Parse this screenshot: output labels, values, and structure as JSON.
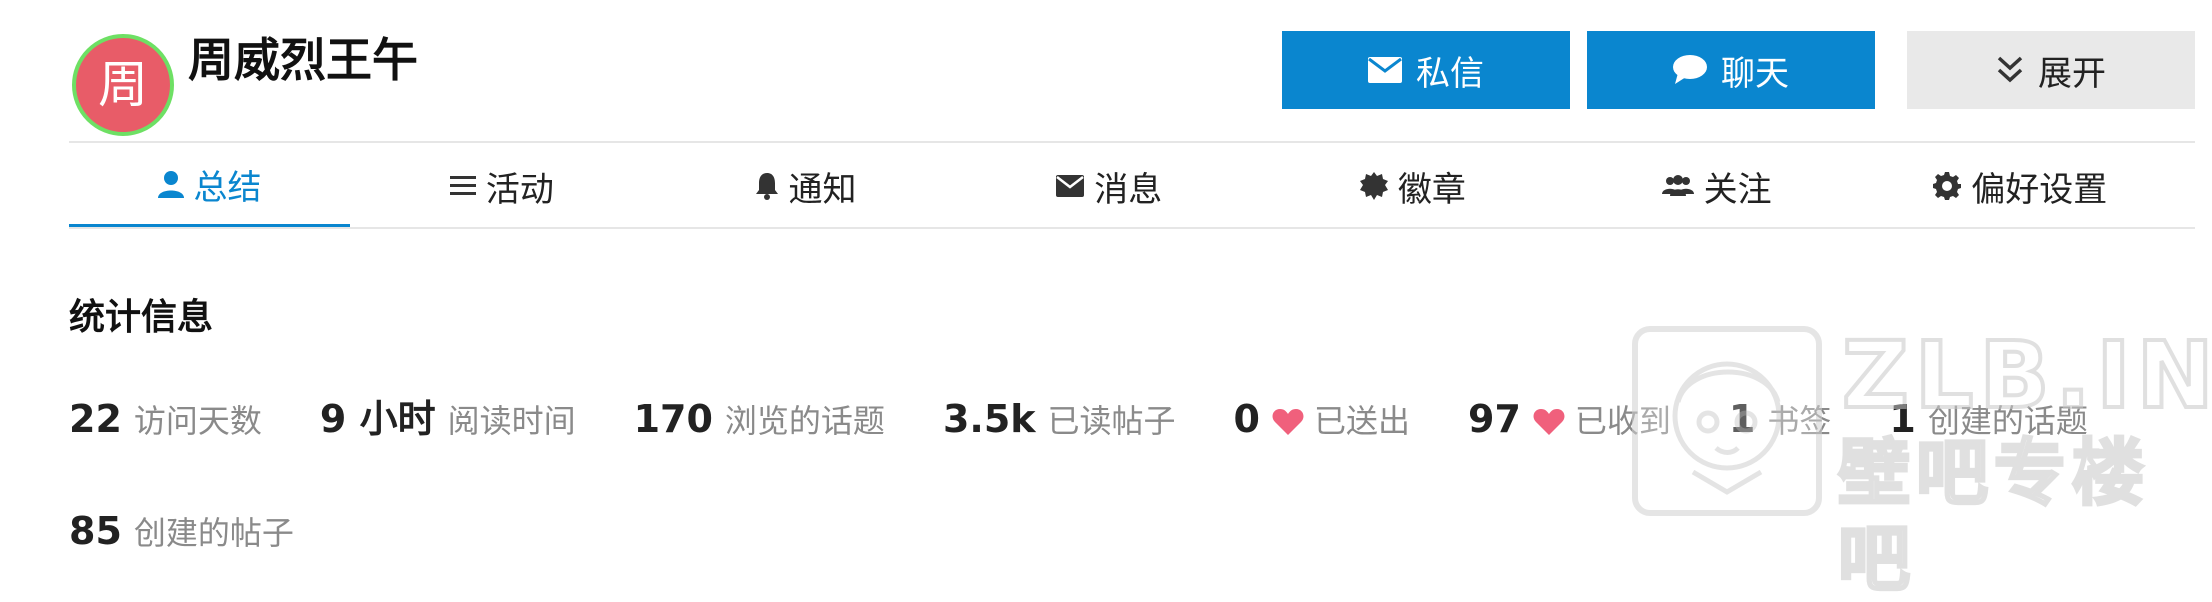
{
  "profile": {
    "avatar_letter": "周",
    "avatar_color": "#e85c68",
    "avatar_ring_color": "#6ee064",
    "username": "周威烈王午"
  },
  "actions": {
    "pm": {
      "label": "私信",
      "icon": "envelope-icon"
    },
    "chat": {
      "label": "聊天",
      "icon": "speech-bubble-icon"
    },
    "expand": {
      "label": "展开",
      "icon": "double-chevron-down-icon"
    }
  },
  "nav": {
    "items": [
      {
        "label": "总结",
        "icon": "user-icon",
        "active": true
      },
      {
        "label": "活动",
        "icon": "list-icon",
        "active": false
      },
      {
        "label": "通知",
        "icon": "bell-icon",
        "active": false
      },
      {
        "label": "消息",
        "icon": "envelope-icon",
        "active": false
      },
      {
        "label": "徽章",
        "icon": "badge-icon",
        "active": false
      },
      {
        "label": "关注",
        "icon": "users-icon",
        "active": false
      },
      {
        "label": "偏好设置",
        "icon": "gear-icon",
        "active": false
      }
    ]
  },
  "stats": {
    "title": "统计信息",
    "items": [
      {
        "value": "22",
        "label": "访问天数"
      },
      {
        "value": "9 小时",
        "label": "阅读时间"
      },
      {
        "value": "170",
        "label": "浏览的话题"
      },
      {
        "value": "3.5k",
        "label": "已读帖子"
      },
      {
        "value": "0",
        "label": "已送出",
        "icon": "heart-icon"
      },
      {
        "value": "97",
        "label": "已收到",
        "icon": "heart-icon"
      },
      {
        "value": "1",
        "label": "书签"
      },
      {
        "value": "1",
        "label": "创建的话题"
      },
      {
        "value": "85",
        "label": "创建的帖子"
      }
    ]
  },
  "watermark": {
    "top": "ZLB.INK",
    "bottom": "壁吧专楼吧"
  },
  "colors": {
    "accent": "#0a86cf",
    "heart": "#f0607c",
    "muted_text": "#8a8a8a"
  }
}
